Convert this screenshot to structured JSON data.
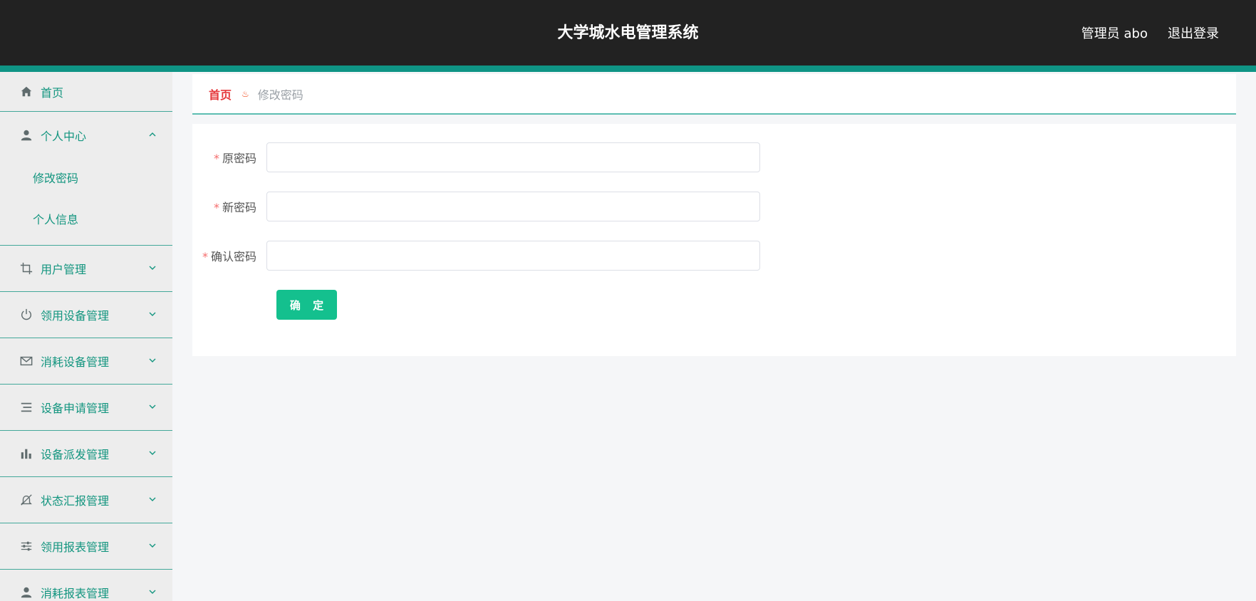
{
  "header": {
    "title": "大学城水电管理系统",
    "user_label": "管理员 abo",
    "logout_label": "退出登录"
  },
  "sidebar": {
    "items": [
      {
        "label": "首页",
        "icon": "home-icon"
      },
      {
        "label": "个人中心",
        "icon": "user-icon",
        "expanded": true,
        "children": [
          {
            "label": "修改密码"
          },
          {
            "label": "个人信息"
          }
        ]
      },
      {
        "label": "用户管理",
        "icon": "crop-icon"
      },
      {
        "label": "领用设备管理",
        "icon": "power-icon"
      },
      {
        "label": "消耗设备管理",
        "icon": "mail-icon"
      },
      {
        "label": "设备申请管理",
        "icon": "list-icon"
      },
      {
        "label": "设备派发管理",
        "icon": "bar-chart-icon"
      },
      {
        "label": "状态汇报管理",
        "icon": "bell-off-icon"
      },
      {
        "label": "领用报表管理",
        "icon": "sliders-icon"
      },
      {
        "label": "消耗报表管理",
        "icon": "user-icon"
      }
    ]
  },
  "breadcrumb": {
    "home": "首页",
    "current": "修改密码"
  },
  "form": {
    "fields": [
      {
        "label": "原密码",
        "required": true,
        "value": ""
      },
      {
        "label": "新密码",
        "required": true,
        "value": ""
      },
      {
        "label": "确认密码",
        "required": true,
        "value": ""
      }
    ],
    "submit_label": "确 定"
  },
  "colors": {
    "header_bg": "#222222",
    "accent": "#0f9485",
    "menu_text": "#13957f",
    "button": "#14c08e",
    "breadcrumb_home": "#e5383b"
  }
}
